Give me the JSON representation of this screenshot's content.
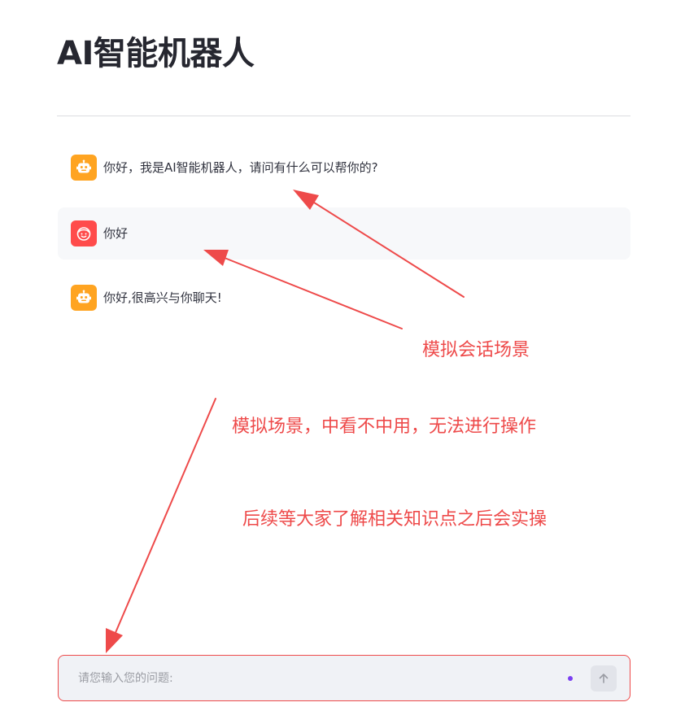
{
  "page": {
    "title": "AI智能机器人"
  },
  "messages": [
    {
      "role": "assistant",
      "text": "你好，我是AI智能机器人，请问有什么可以帮你的?"
    },
    {
      "role": "user",
      "text": "你好"
    },
    {
      "role": "assistant",
      "text": "你好,很高兴与你聊天!"
    }
  ],
  "annotations": {
    "note1": "模拟会话场景",
    "note2": "模拟场景，中看不中用，无法进行操作",
    "note3": "后续等大家了解相关知识点之后会实操"
  },
  "chat_input": {
    "placeholder": "请您输入您的问题:",
    "value": ""
  },
  "icons": {
    "assistant_avatar": "robot-icon",
    "user_avatar": "smiley-face-icon",
    "send": "arrow-up-icon"
  },
  "colors": {
    "assistant_avatar_bg": "#ffa421",
    "user_avatar_bg": "#ff4b4b",
    "annotation": "#ee4a4a",
    "typing_dot": "#7b3ff2"
  }
}
